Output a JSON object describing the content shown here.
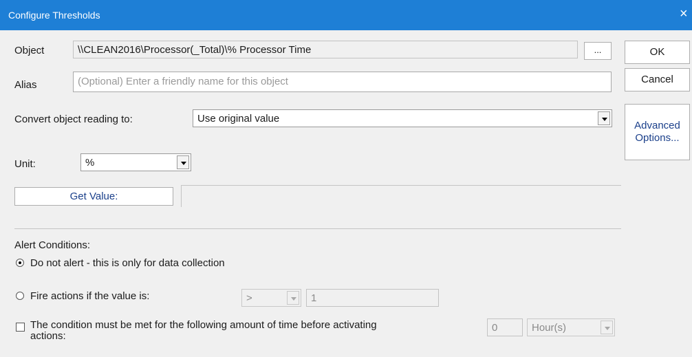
{
  "window": {
    "title": "Configure Thresholds",
    "close_glyph": "×"
  },
  "object": {
    "label": "Object",
    "value": "\\\\CLEAN2016\\Processor(_Total)\\% Processor Time",
    "browse_label": "..."
  },
  "alias": {
    "label": "Alias",
    "placeholder": "(Optional) Enter a friendly name for this object",
    "value": ""
  },
  "convert": {
    "label": "Convert object reading to:",
    "selected": "Use original value"
  },
  "unit": {
    "label": "Unit:",
    "selected": "%"
  },
  "get_value": {
    "button_label": "Get Value:",
    "value": ""
  },
  "buttons": {
    "ok": "OK",
    "cancel": "Cancel",
    "advanced_line1": "Advanced",
    "advanced_line2": "Options..."
  },
  "alert": {
    "heading": "Alert Conditions:",
    "no_alert_label": "Do not alert - this is only for data collection",
    "no_alert_checked": true,
    "fire_label": "Fire actions if the value is:",
    "fire_checked": false,
    "operator": ">",
    "threshold_value": "1",
    "duration_label_line1": "The condition must be met for the following amount of time before activating",
    "duration_label_line2": "actions:",
    "duration_checked": false,
    "duration_value": "0",
    "duration_unit": "Hour(s)"
  }
}
